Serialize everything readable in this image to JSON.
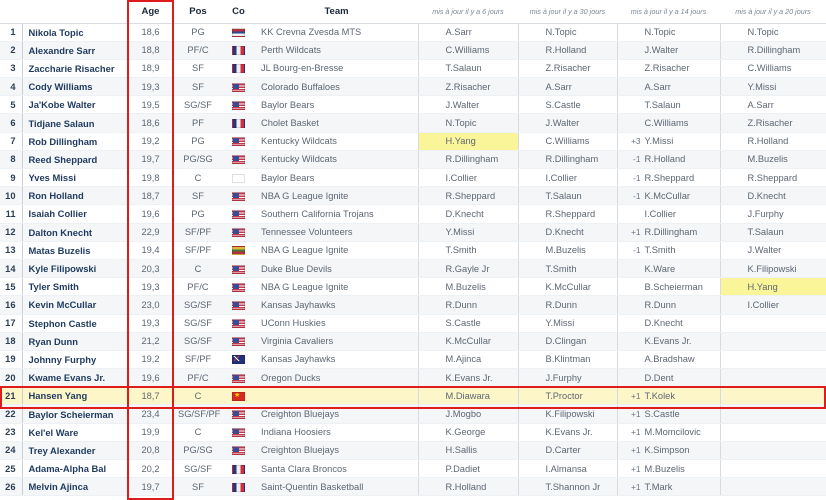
{
  "table": {
    "headers": {
      "rank": "",
      "name": "",
      "age": "Age",
      "pos": "Pos",
      "co": "Co",
      "team": "Team",
      "hist1": "mis à jour il y a 6 jours",
      "hist2": "mis à jour il y a 30 jours",
      "hist3": "mis à jour il y a 14 jours",
      "hist4": "mis à jour il y a 20 jours"
    },
    "highlight_color": "#fdf6c8",
    "annotation_color": "#e01b1b",
    "rows": [
      {
        "rank": "1",
        "name": "Nikola Topic",
        "age": "18,6",
        "pos": "PG",
        "flag": "rs",
        "team": "KK Crevna Zvesda MTS",
        "h1": {
          "delta": "",
          "name": "A.Sarr"
        },
        "h2": {
          "delta": "",
          "name": "N.Topic"
        },
        "h3": {
          "delta": "",
          "name": "N.Topic"
        },
        "h4": {
          "delta": "",
          "name": "N.Topic"
        }
      },
      {
        "rank": "2",
        "name": "Alexandre Sarr",
        "age": "18,8",
        "pos": "PF/C",
        "flag": "fr",
        "team": "Perth Wildcats",
        "h1": {
          "delta": "",
          "name": "C.Williams"
        },
        "h2": {
          "delta": "",
          "name": "R.Holland"
        },
        "h3": {
          "delta": "",
          "name": "J.Walter"
        },
        "h4": {
          "delta": "",
          "name": "R.Dillingham"
        }
      },
      {
        "rank": "3",
        "name": "Zaccharie Risacher",
        "age": "18,9",
        "pos": "SF",
        "flag": "fr",
        "team": "JL Bourg-en-Bresse",
        "h1": {
          "delta": "",
          "name": "T.Salaun"
        },
        "h2": {
          "delta": "",
          "name": "Z.Risacher"
        },
        "h3": {
          "delta": "",
          "name": "Z.Risacher"
        },
        "h4": {
          "delta": "",
          "name": "C.Williams"
        }
      },
      {
        "rank": "4",
        "name": "Cody Williams",
        "age": "19,3",
        "pos": "SF",
        "flag": "us",
        "team": "Colorado Buffaloes",
        "h1": {
          "delta": "",
          "name": "Z.Risacher"
        },
        "h2": {
          "delta": "",
          "name": "A.Sarr"
        },
        "h3": {
          "delta": "",
          "name": "A.Sarr"
        },
        "h4": {
          "delta": "",
          "name": "Y.Missi"
        }
      },
      {
        "rank": "5",
        "name": "Ja'Kobe Walter",
        "age": "19,5",
        "pos": "SG/SF",
        "flag": "us",
        "team": "Baylor Bears",
        "h1": {
          "delta": "",
          "name": "J.Walter"
        },
        "h2": {
          "delta": "",
          "name": "S.Castle"
        },
        "h3": {
          "delta": "",
          "name": "T.Salaun"
        },
        "h4": {
          "delta": "",
          "name": "A.Sarr"
        }
      },
      {
        "rank": "6",
        "name": "Tidjane Salaun",
        "age": "18,6",
        "pos": "PF",
        "flag": "fr",
        "team": "Cholet Basket",
        "h1": {
          "delta": "",
          "name": "N.Topic"
        },
        "h2": {
          "delta": "",
          "name": "J.Walter"
        },
        "h3": {
          "delta": "",
          "name": "C.Williams"
        },
        "h4": {
          "delta": "",
          "name": "Z.Risacher"
        }
      },
      {
        "rank": "7",
        "name": "Rob Dillingham",
        "age": "19,2",
        "pos": "PG",
        "flag": "us",
        "team": "Kentucky Wildcats",
        "h1": {
          "delta": "",
          "name": "H.Yang",
          "hl": true
        },
        "h2": {
          "delta": "",
          "name": "C.Williams"
        },
        "h3": {
          "delta": "+3",
          "name": "Y.Missi"
        },
        "h4": {
          "delta": "",
          "name": "R.Holland"
        }
      },
      {
        "rank": "8",
        "name": "Reed Sheppard",
        "age": "19,7",
        "pos": "PG/SG",
        "flag": "us",
        "team": "Kentucky Wildcats",
        "h1": {
          "delta": "",
          "name": "R.Dillingham"
        },
        "h2": {
          "delta": "",
          "name": "R.Dillingham"
        },
        "h3": {
          "delta": "-1",
          "name": "R.Holland"
        },
        "h4": {
          "delta": "",
          "name": "M.Buzelis"
        }
      },
      {
        "rank": "9",
        "name": "Yves Missi",
        "age": "19,8",
        "pos": "C",
        "flag": "cm",
        "team": "Baylor Bears",
        "h1": {
          "delta": "",
          "name": "I.Collier"
        },
        "h2": {
          "delta": "",
          "name": "I.Collier"
        },
        "h3": {
          "delta": "-1",
          "name": "R.Sheppard"
        },
        "h4": {
          "delta": "",
          "name": "R.Sheppard"
        }
      },
      {
        "rank": "10",
        "name": "Ron Holland",
        "age": "18,7",
        "pos": "SF",
        "flag": "us",
        "team": "NBA G League Ignite",
        "h1": {
          "delta": "",
          "name": "R.Sheppard"
        },
        "h2": {
          "delta": "",
          "name": "T.Salaun"
        },
        "h3": {
          "delta": "-1",
          "name": "K.McCullar"
        },
        "h4": {
          "delta": "",
          "name": "D.Knecht"
        }
      },
      {
        "rank": "11",
        "name": "Isaiah Collier",
        "age": "19,6",
        "pos": "PG",
        "flag": "us",
        "team": "Southern California Trojans",
        "h1": {
          "delta": "",
          "name": "D.Knecht"
        },
        "h2": {
          "delta": "",
          "name": "R.Sheppard"
        },
        "h3": {
          "delta": "",
          "name": "I.Collier"
        },
        "h4": {
          "delta": "",
          "name": "J.Furphy"
        }
      },
      {
        "rank": "12",
        "name": "Dalton Knecht",
        "age": "22,9",
        "pos": "SF/PF",
        "flag": "us",
        "team": "Tennessee Volunteers",
        "h1": {
          "delta": "",
          "name": "Y.Missi"
        },
        "h2": {
          "delta": "",
          "name": "D.Knecht"
        },
        "h3": {
          "delta": "+1",
          "name": "R.Dillingham"
        },
        "h4": {
          "delta": "",
          "name": "T.Salaun"
        }
      },
      {
        "rank": "13",
        "name": "Matas Buzelis",
        "age": "19,4",
        "pos": "SF/PF",
        "flag": "lt",
        "team": "NBA G League Ignite",
        "h1": {
          "delta": "",
          "name": "T.Smith"
        },
        "h2": {
          "delta": "",
          "name": "M.Buzelis"
        },
        "h3": {
          "delta": "-1",
          "name": "T.Smith"
        },
        "h4": {
          "delta": "",
          "name": "J.Walter"
        }
      },
      {
        "rank": "14",
        "name": "Kyle Filipowski",
        "age": "20,3",
        "pos": "C",
        "flag": "us",
        "team": "Duke Blue Devils",
        "h1": {
          "delta": "",
          "name": "R.Gayle Jr"
        },
        "h2": {
          "delta": "",
          "name": "T.Smith"
        },
        "h3": {
          "delta": "",
          "name": "K.Ware"
        },
        "h4": {
          "delta": "",
          "name": "K.Filipowski"
        }
      },
      {
        "rank": "15",
        "name": "Tyler Smith",
        "age": "19,3",
        "pos": "PF/C",
        "flag": "us",
        "team": "NBA G League Ignite",
        "h1": {
          "delta": "",
          "name": "M.Buzelis"
        },
        "h2": {
          "delta": "",
          "name": "K.McCullar"
        },
        "h3": {
          "delta": "",
          "name": "B.Scheierman"
        },
        "h4": {
          "delta": "",
          "name": "H.Yang",
          "hl": true
        }
      },
      {
        "rank": "16",
        "name": "Kevin McCullar",
        "age": "23,0",
        "pos": "SG/SF",
        "flag": "us",
        "team": "Kansas Jayhawks",
        "h1": {
          "delta": "",
          "name": "R.Dunn"
        },
        "h2": {
          "delta": "",
          "name": "R.Dunn"
        },
        "h3": {
          "delta": "",
          "name": "R.Dunn"
        },
        "h4": {
          "delta": "",
          "name": "I.Collier"
        }
      },
      {
        "rank": "17",
        "name": "Stephon Castle",
        "age": "19,3",
        "pos": "SG/SF",
        "flag": "us",
        "team": "UConn Huskies",
        "h1": {
          "delta": "",
          "name": "S.Castle"
        },
        "h2": {
          "delta": "",
          "name": "Y.Missi"
        },
        "h3": {
          "delta": "",
          "name": "D.Knecht"
        },
        "h4": {
          "delta": "",
          "name": ""
        }
      },
      {
        "rank": "18",
        "name": "Ryan Dunn",
        "age": "21,2",
        "pos": "SG/SF",
        "flag": "us",
        "team": "Virginia Cavaliers",
        "h1": {
          "delta": "",
          "name": "K.McCullar"
        },
        "h2": {
          "delta": "",
          "name": "D.Clingan"
        },
        "h3": {
          "delta": "",
          "name": "K.Evans Jr."
        },
        "h4": {
          "delta": "",
          "name": ""
        }
      },
      {
        "rank": "19",
        "name": "Johnny Furphy",
        "age": "19,2",
        "pos": "SF/PF",
        "flag": "au",
        "team": "Kansas Jayhawks",
        "h1": {
          "delta": "",
          "name": "M.Ajinca"
        },
        "h2": {
          "delta": "",
          "name": "B.Klintman"
        },
        "h3": {
          "delta": "",
          "name": "A.Bradshaw"
        },
        "h4": {
          "delta": "",
          "name": ""
        }
      },
      {
        "rank": "20",
        "name": "Kwame Evans Jr.",
        "age": "19,6",
        "pos": "PF/C",
        "flag": "us",
        "team": "Oregon Ducks",
        "h1": {
          "delta": "",
          "name": "K.Evans Jr."
        },
        "h2": {
          "delta": "",
          "name": "J.Furphy"
        },
        "h3": {
          "delta": "",
          "name": "D.Dent"
        },
        "h4": {
          "delta": "",
          "name": ""
        }
      },
      {
        "rank": "21",
        "name": "Hansen Yang",
        "age": "18,7",
        "pos": "C",
        "flag": "cn",
        "team": "",
        "h1": {
          "delta": "",
          "name": "M.Diawara"
        },
        "h2": {
          "delta": "",
          "name": "T.Proctor"
        },
        "h3": {
          "delta": "+1",
          "name": "T.Kolek"
        },
        "h4": {
          "delta": "",
          "name": ""
        },
        "selected": true
      },
      {
        "rank": "22",
        "name": "Baylor Scheierman",
        "age": "23,4",
        "pos": "SG/SF/PF",
        "flag": "us",
        "team": "Creighton Bluejays",
        "h1": {
          "delta": "",
          "name": "J.Mogbo"
        },
        "h2": {
          "delta": "",
          "name": "K.Filipowski"
        },
        "h3": {
          "delta": "+1",
          "name": "S.Castle"
        },
        "h4": {
          "delta": "",
          "name": ""
        }
      },
      {
        "rank": "23",
        "name": "Kel'el Ware",
        "age": "19,9",
        "pos": "C",
        "flag": "us",
        "team": "Indiana Hoosiers",
        "h1": {
          "delta": "",
          "name": "K.George"
        },
        "h2": {
          "delta": "",
          "name": "K.Evans Jr."
        },
        "h3": {
          "delta": "+1",
          "name": "M.Momcilovic"
        },
        "h4": {
          "delta": "",
          "name": ""
        }
      },
      {
        "rank": "24",
        "name": "Trey Alexander",
        "age": "20,8",
        "pos": "PG/SG",
        "flag": "us",
        "team": "Creighton Bluejays",
        "h1": {
          "delta": "",
          "name": "H.Sallis"
        },
        "h2": {
          "delta": "",
          "name": "D.Carter"
        },
        "h3": {
          "delta": "+1",
          "name": "K.Simpson"
        },
        "h4": {
          "delta": "",
          "name": ""
        }
      },
      {
        "rank": "25",
        "name": "Adama-Alpha Bal",
        "age": "20,2",
        "pos": "SG/SF",
        "flag": "fr",
        "team": "Santa Clara Broncos",
        "h1": {
          "delta": "",
          "name": "P.Dadiet"
        },
        "h2": {
          "delta": "",
          "name": "I.Almansa"
        },
        "h3": {
          "delta": "+1",
          "name": "M.Buzelis"
        },
        "h4": {
          "delta": "",
          "name": ""
        }
      },
      {
        "rank": "26",
        "name": "Melvin Ajinca",
        "age": "19,7",
        "pos": "SF",
        "flag": "fr",
        "team": "Saint-Quentin Basketball",
        "h1": {
          "delta": "",
          "name": "R.Holland"
        },
        "h2": {
          "delta": "",
          "name": "T.Shannon Jr"
        },
        "h3": {
          "delta": "+1",
          "name": "T.Mark"
        },
        "h4": {
          "delta": "",
          "name": ""
        }
      }
    ]
  }
}
